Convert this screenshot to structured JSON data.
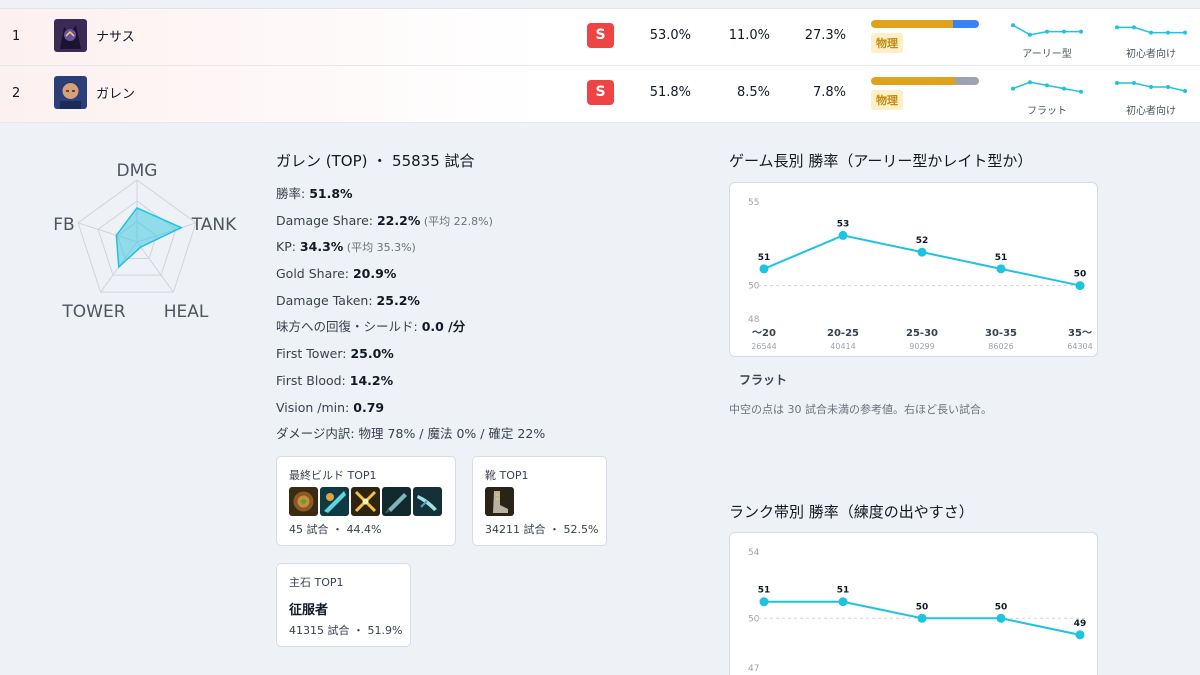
{
  "rows": [
    {
      "rank": "1",
      "name": "ナサス",
      "tier": "S",
      "winrate": "53.0%",
      "pickrate": "11.0%",
      "banrate": "27.3%",
      "dmg": {
        "phys": 76,
        "mag": 24,
        "tru": 0
      },
      "dmg_tag": "物理",
      "spark1_label": "アーリー型",
      "spark2_label": "初心者向け",
      "spark1": [
        54,
        51,
        52,
        52,
        52
      ],
      "spark2": [
        51,
        51,
        50,
        50,
        50
      ]
    },
    {
      "rank": "2",
      "name": "ガレン",
      "tier": "S",
      "winrate": "51.8%",
      "pickrate": "8.5%",
      "banrate": "7.8%",
      "dmg": {
        "phys": 78,
        "mag": 0,
        "tru": 22
      },
      "dmg_tag": "物理",
      "spark1_label": "フラット",
      "spark2_label": "初心者向け",
      "spark1": [
        51,
        53,
        52,
        51,
        50
      ],
      "spark2": [
        51,
        51,
        50,
        50,
        49
      ]
    }
  ],
  "radar": {
    "labels": [
      "DMG",
      "TANK",
      "HEAL",
      "TOWER",
      "FB"
    ],
    "values": [
      0.55,
      0.75,
      0.1,
      0.5,
      0.35
    ]
  },
  "detail": {
    "title": "ガレン (TOP) ・ 55835 試合",
    "lines": [
      {
        "label": "勝率: ",
        "value": "51.8%",
        "avg": ""
      },
      {
        "label": "Damage Share: ",
        "value": "22.2%",
        "avg": " (平均 22.8%)"
      },
      {
        "label": "KP: ",
        "value": "34.3%",
        "avg": " (平均 35.3%)"
      },
      {
        "label": "Gold Share: ",
        "value": "20.9%",
        "avg": ""
      },
      {
        "label": "Damage Taken: ",
        "value": "25.2%",
        "avg": ""
      },
      {
        "label": "味方への回復・シールド: ",
        "value": "0.0 /分",
        "avg": ""
      },
      {
        "label": "First Tower: ",
        "value": "25.0%",
        "avg": ""
      },
      {
        "label": "First Blood: ",
        "value": "14.2%",
        "avg": ""
      },
      {
        "label": "Vision /min: ",
        "value": "0.79",
        "avg": ""
      },
      {
        "label": "ダメージ内訳: 物理 78% / 魔法 0% / 確定 22%",
        "value": "",
        "avg": ""
      }
    ]
  },
  "cards": {
    "build": {
      "title": "最終ビルド TOP1",
      "meta": "45 試合 ・ 44.4%"
    },
    "boots": {
      "title": "靴 TOP1",
      "meta": "34211 試合 ・ 52.5%"
    },
    "rune": {
      "title": "主石 TOP1",
      "name": "征服者",
      "meta": "41315 試合 ・ 51.9%"
    }
  },
  "game_length": {
    "title": "ゲーム長別 勝率（アーリー型かレイト型か）",
    "verdict": "フラット",
    "note": "中空の点は 30 試合未満の参考値。右ほど長い試合。",
    "chart_data": {
      "type": "line",
      "categories": [
        "〜20",
        "20-25",
        "25-30",
        "30-35",
        "35〜"
      ],
      "counts": [
        "26544",
        "40414",
        "90299",
        "86026",
        "64304"
      ],
      "values": [
        51,
        53,
        52,
        51,
        50
      ],
      "value_labels": [
        "51",
        "53",
        "52",
        "51",
        "50"
      ],
      "yticks": [
        "55",
        "50",
        "48"
      ],
      "ylim": [
        48,
        55
      ],
      "refline": 50
    }
  },
  "rank_band": {
    "title": "ランク帯別 勝率（練度の出やすさ）",
    "chart_data": {
      "type": "line",
      "values": [
        51,
        51,
        50,
        50,
        49
      ],
      "value_labels": [
        "51",
        "51",
        "50",
        "50",
        "49"
      ],
      "yticks": [
        "54",
        "50",
        "47"
      ],
      "ylim": [
        47,
        54
      ],
      "refline": 50
    }
  },
  "colors": {
    "accent": "#1ec3e0",
    "tier_s": "#ef4444",
    "phys": "#e0a21a",
    "mag": "#3b82f6",
    "true": "#9ca3af"
  }
}
